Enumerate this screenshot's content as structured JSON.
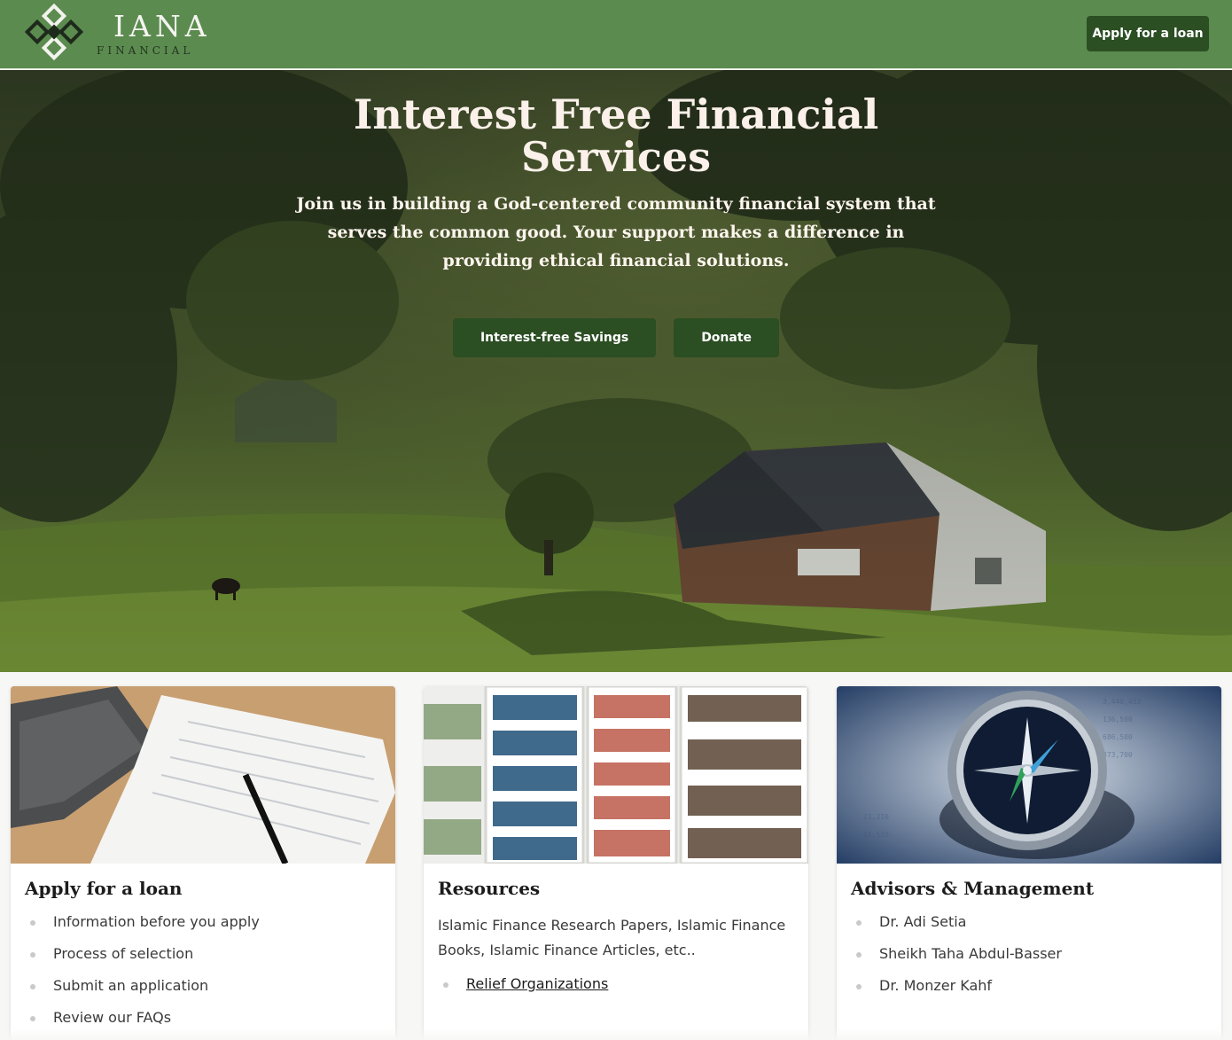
{
  "header": {
    "logo_word": "IANA",
    "logo_sub": "FINANCIAL",
    "apply_button": "Apply for a loan"
  },
  "hero": {
    "title": "Interest Free Financial Services",
    "subtitle": "Join us in building a God-centered community financial system that serves the common good. Your support makes a difference in providing ethical financial solutions.",
    "buttons": [
      "Interest-free Savings",
      "Donate"
    ]
  },
  "cards": [
    {
      "title": "Apply for a loan",
      "items": [
        "Information before you apply",
        "Process of selection",
        "Submit an application",
        "Review our FAQs"
      ]
    },
    {
      "title": "Resources",
      "text": "Islamic Finance Research Papers, Islamic Finance Books, Islamic Finance Articles, etc..",
      "links": [
        "Relief Organizations"
      ]
    },
    {
      "title": "Advisors & Management",
      "items": [
        "Dr. Adi Setia",
        "Sheikh Taha Abdul-Basser",
        "Dr. Monzer Kahf"
      ]
    }
  ],
  "colors": {
    "header_green": "#5b8b4f",
    "button_green": "#2b4e23"
  },
  "icons": [
    "logo-diamond-mark"
  ]
}
